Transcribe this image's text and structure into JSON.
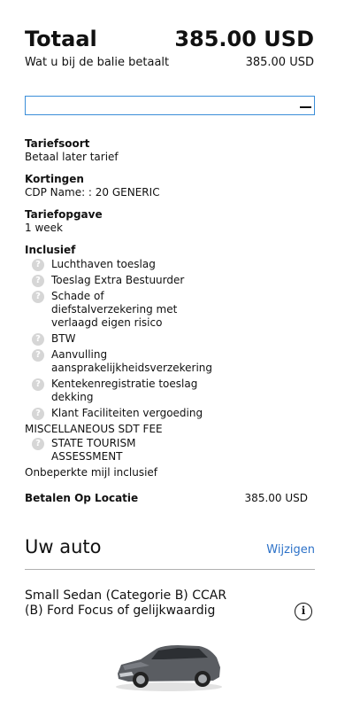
{
  "summary": {
    "total_label": "Totaal",
    "total_amount": "385.00 USD",
    "counter_label": "Wat u bij de balie betaalt",
    "counter_amount": "385.00 USD"
  },
  "rate": {
    "type_title": "Tariefsoort",
    "type_value": "Betaal later tarief",
    "discounts_title": "Kortingen",
    "discounts_value": "CDP Name: : 20 GENERIC",
    "statement_title": "Tariefopgave",
    "statement_value": "1 week"
  },
  "included": {
    "title": "Inclusief",
    "items": [
      "Luchthaven toeslag",
      "Toeslag Extra Bestuurder",
      "Schade of diefstalverzekering met verlaagd eigen risico",
      "BTW",
      "Aanvulling aansprakelijkheidsverzekering",
      "Kentekenregistratie toeslag dekking",
      "Klant Faciliteiten vergoeding"
    ],
    "misc_title": "MISCELLANEOUS SDT FEE",
    "misc_items": [
      "STATE TOURISM ASSESSMENT"
    ],
    "unlimited": "Onbeperkte mijl inclusief"
  },
  "pay_location": {
    "label": "Betalen Op Locatie",
    "amount": "385.00 USD"
  },
  "car": {
    "section_title": "Uw auto",
    "change_link": "Wijzigen",
    "name": "Small Sedan (Categorie B) CCAR (B) Ford Focus of gelijkwaardig"
  },
  "icons": {
    "help": "question-icon",
    "info": "info-icon",
    "collapse": "minus-icon"
  },
  "colors": {
    "link": "#2d72c8",
    "focus_border": "#3b8ed8",
    "help_icon_bg": "#d6d6d6"
  }
}
